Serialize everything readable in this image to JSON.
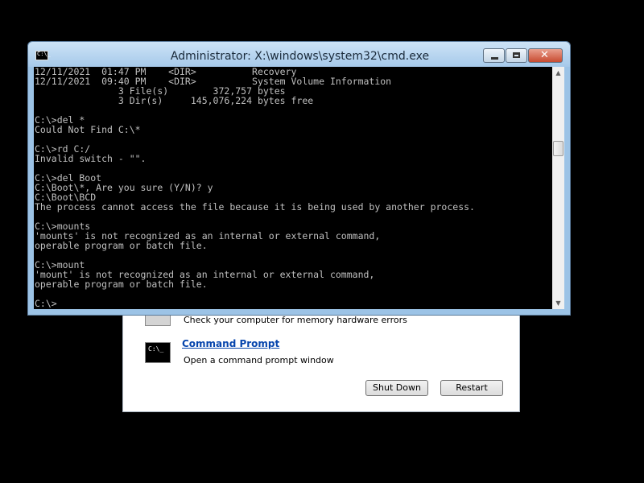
{
  "window": {
    "title": "Administrator: X:\\windows\\system32\\cmd.exe",
    "icon_label": "C:\\_"
  },
  "console": {
    "lines": [
      "12/11/2021  01:47 PM    <DIR>          Recovery",
      "12/11/2021  09:40 PM    <DIR>          System Volume Information",
      "               3 File(s)        372,757 bytes",
      "               3 Dir(s)     145,076,224 bytes free",
      "",
      "C:\\>del *",
      "Could Not Find C:\\*",
      "",
      "C:\\>rd C:/",
      "Invalid switch - \"\".",
      "",
      "C:\\>del Boot",
      "C:\\Boot\\*, Are you sure (Y/N)? y",
      "C:\\Boot\\BCD",
      "The process cannot access the file because it is being used by another process.",
      "",
      "C:\\>mounts",
      "'mounts' is not recognized as an internal or external command,",
      "operable program or batch file.",
      "",
      "C:\\>mount",
      "'mount' is not recognized as an internal or external command,",
      "operable program or batch file.",
      "",
      "C:\\>"
    ]
  },
  "recovery": {
    "memory_description": "Check your computer for memory hardware errors",
    "command_prompt_link": "Command Prompt",
    "command_prompt_description": "Open a command prompt window",
    "command_prompt_icon_label": "C:\\_",
    "shutdown_label": "Shut Down",
    "restart_label": "Restart"
  },
  "icons": {
    "minimize": "minimize-icon",
    "maximize": "maximize-icon",
    "close": "close-icon",
    "close_glyph": "✕",
    "scroll_up_glyph": "▲",
    "scroll_down_glyph": "▼"
  },
  "colors": {
    "console_bg": "#000000",
    "console_text": "#c0c0c0",
    "close_button": "#c84b31",
    "link": "#0645ad"
  }
}
